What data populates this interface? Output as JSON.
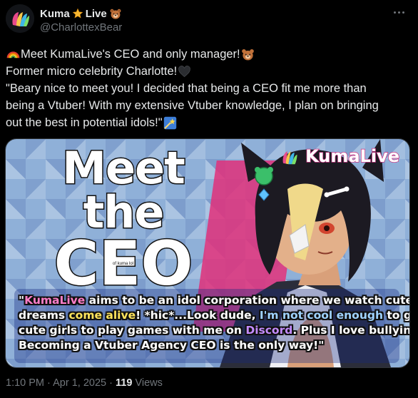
{
  "author": {
    "display_name": "Kuma",
    "display_name_suffix": "Live",
    "handle": "@CharlottexBear",
    "name_emoji_1": "star-emoji",
    "name_emoji_2": "bear-emoji"
  },
  "more_button_icon": "more-horizontal-icon",
  "post": {
    "lines": [
      {
        "emoji_before": "rainbow-emoji",
        "text": "Meet KumaLive's CEO and only manager!",
        "emoji_after": "bear-emoji"
      },
      {
        "text": "Former micro celebrity Charlotte!",
        "emoji_after": "black-heart-emoji"
      },
      {
        "text": "\"Beary nice to meet you! I decided that being a CEO fit me more than"
      },
      {
        "text": "being a Vtuber! With my extensive Vtuber knowledge, I plan on bringing"
      },
      {
        "text": "out the best in potential idols!\"",
        "emoji_after": "shooting-star-emoji"
      }
    ]
  },
  "media": {
    "headline_line1": "Meet the",
    "headline_line2": "CEO",
    "fine_print": "of kuma lol",
    "brand_name": "KumaLive",
    "quote": {
      "line1": [
        "\"",
        "KumaLive",
        " aims to be an idol corporation where we watch cute girls'"
      ],
      "line2": [
        "dreams ",
        "come alive",
        "! *hic*...Look dude, ",
        "I'm not cool enough",
        " to get"
      ],
      "line3": [
        "cute girls to play games with me on ",
        "Discord",
        ". Plus I love bullying."
      ],
      "line4": [
        "Becoming a Vtuber Agency CEO is the only way!\""
      ]
    }
  },
  "footer": {
    "time": "1:10 PM",
    "separator": "·",
    "date": "Apr 1, 2025",
    "views_count": "119",
    "views_label": "Views"
  },
  "colors": {
    "background": "#000000",
    "text_primary": "#e7e9ea",
    "text_secondary": "#71767b",
    "accent_pink": "#ff7ec8",
    "accent_yellow": "#ffe45c"
  }
}
